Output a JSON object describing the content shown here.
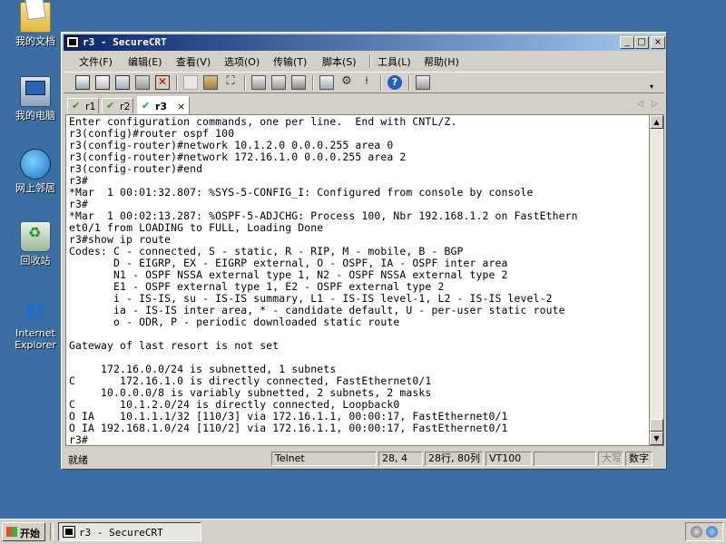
{
  "desktop": {
    "icons": [
      {
        "label": "我的文档"
      },
      {
        "label": "我的电脑"
      },
      {
        "label": "网上邻居"
      },
      {
        "label": "回收站"
      },
      {
        "label": "Internet Explorer"
      }
    ]
  },
  "window": {
    "title": "r3 - SecureCRT",
    "controls": {
      "minimize": "_",
      "maximize": "□",
      "close": "×"
    }
  },
  "menu": {
    "items": [
      "文件(F)",
      "编辑(E)",
      "查看(V)",
      "选项(O)",
      "传输(T)",
      "脚本(S)",
      "工具(L)",
      "帮助(H)"
    ]
  },
  "tabs": {
    "items": [
      {
        "label": "r1",
        "active": false
      },
      {
        "label": "r2",
        "active": false
      },
      {
        "label": "r3",
        "active": true,
        "close": "×"
      }
    ],
    "arrow_left": "◁",
    "arrow_right": "▷"
  },
  "terminal": {
    "lines": [
      "Enter configuration commands, one per line.  End with CNTL/Z.",
      "r3(config)#router ospf 100",
      "r3(config-router)#network 10.1.2.0 0.0.0.255 area 0",
      "r3(config-router)#network 172.16.1.0 0.0.0.255 area 2",
      "r3(config-router)#end",
      "r3#",
      "*Mar  1 00:01:32.807: %SYS-5-CONFIG_I: Configured from console by console",
      "r3#",
      "*Mar  1 00:02:13.287: %OSPF-5-ADJCHG: Process 100, Nbr 192.168.1.2 on FastEthern",
      "et0/1 from LOADING to FULL, Loading Done",
      "r3#show ip route",
      "Codes: C - connected, S - static, R - RIP, M - mobile, B - BGP",
      "       D - EIGRP, EX - EIGRP external, O - OSPF, IA - OSPF inter area",
      "       N1 - OSPF NSSA external type 1, N2 - OSPF NSSA external type 2",
      "       E1 - OSPF external type 1, E2 - OSPF external type 2",
      "       i - IS-IS, su - IS-IS summary, L1 - IS-IS level-1, L2 - IS-IS level-2",
      "       ia - IS-IS inter area, * - candidate default, U - per-user static route",
      "       o - ODR, P - periodic downloaded static route",
      "",
      "Gateway of last resort is not set",
      "",
      "     172.16.0.0/24 is subnetted, 1 subnets",
      "C       172.16.1.0 is directly connected, FastEthernet0/1",
      "     10.0.0.0/8 is variably subnetted, 2 subnets, 2 masks",
      "C       10.1.2.0/24 is directly connected, Loopback0",
      "O IA    10.1.1.1/32 [110/3] via 172.16.1.1, 00:00:17, FastEthernet0/1",
      "O IA 192.168.1.0/24 [110/2] via 172.16.1.1, 00:00:17, FastEthernet0/1",
      "r3#"
    ]
  },
  "status": {
    "ready": "就绪",
    "protocol": "Telnet",
    "cursor": "28,  4",
    "size": "28行, 80列",
    "emulation": "VT100",
    "caps": "大写",
    "num": "数字"
  },
  "taskbar": {
    "start_label": "开始",
    "task_label": "r3 - SecureCRT"
  }
}
